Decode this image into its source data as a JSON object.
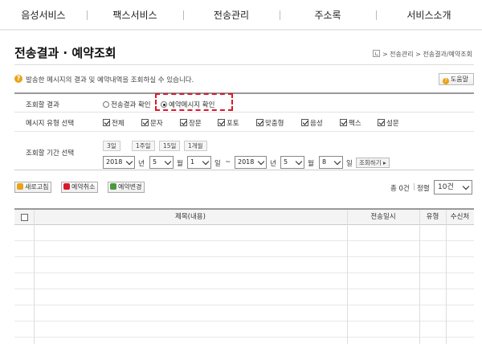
{
  "nav": {
    "items": [
      "음성서비스",
      "팩스서비스",
      "전송관리",
      "주소록",
      "서비스소개"
    ]
  },
  "page": {
    "title": "전송결과 · 예약조회",
    "breadcrumb": "> 전송관리 > 전송결과/예약조회",
    "info": "발송한 메시지의 결과 및 예약내역을 조회하실 수 있습니다.",
    "help": "도움말"
  },
  "filter": {
    "result_label": "조회할 결과",
    "result_options": [
      "전송결과 확인",
      "예약메시지 확인"
    ],
    "result_selected": "예약메시지 확인",
    "type_label": "메시지 유형 선택",
    "type_options": [
      "전체",
      "문자",
      "장문",
      "포토",
      "맞춤형",
      "음성",
      "팩스",
      "설문"
    ],
    "period_label": "조회할 기간 선택",
    "period_buttons": [
      "3일",
      "1주일",
      "15일",
      "1개월"
    ],
    "from": {
      "year": "2018",
      "month": "5",
      "day": "1"
    },
    "to": {
      "year": "2018",
      "month": "5",
      "day": "8"
    },
    "units": {
      "year": "년",
      "month": "월",
      "day": "일",
      "tilde": "~"
    },
    "search_button": "조회하기 ▸"
  },
  "actions": {
    "refresh": "새로고침",
    "cancel_reservation": "예약취소",
    "change_reservation": "예약변경",
    "count": "총 0건",
    "sort": "정렬",
    "per_page": "10건"
  },
  "table": {
    "columns": [
      "제목(내용)",
      "전송일시",
      "유형",
      "수신처"
    ],
    "rows": 7
  },
  "colors": {
    "accent": "#c8102e",
    "highlight": "#d8192c"
  }
}
